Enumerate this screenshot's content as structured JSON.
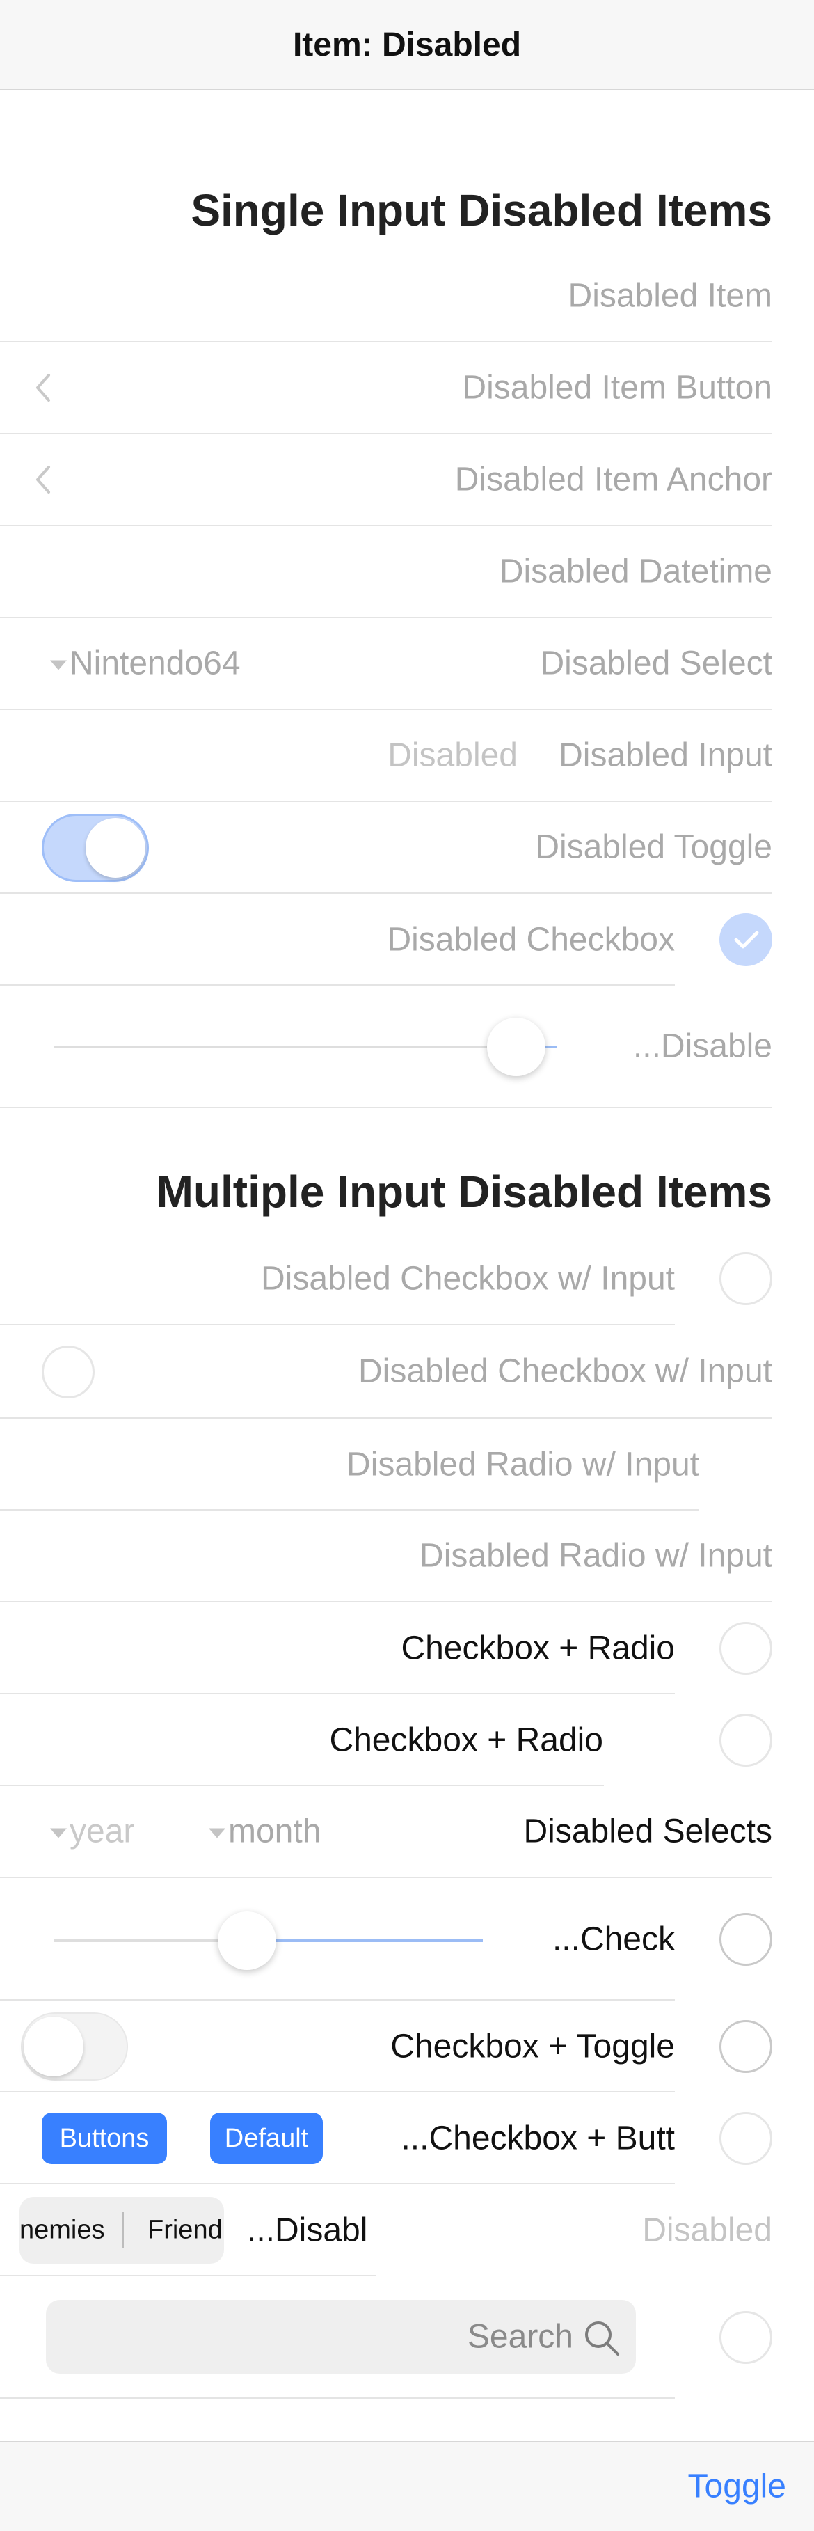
{
  "toolbar": {
    "title": "Item: Disabled"
  },
  "single": {
    "heading": "Single Input Disabled Items",
    "item": "Disabled Item",
    "item_button": "Disabled Item Button",
    "item_anchor": "Disabled Item Anchor",
    "datetime": "Disabled Datetime",
    "select_value": "Nintendo64",
    "select_label": "Disabled Select",
    "input_value": "Disabled",
    "input_label": "Disabled Input",
    "toggle_label": "Disabled Toggle",
    "checkbox_label": "Disabled Checkbox",
    "range_label": "...Disable",
    "range_value": 0.92
  },
  "multiple": {
    "heading": "Multiple Input Disabled Items",
    "checkbox_input_1": "Disabled Checkbox w/ Input",
    "checkbox_input_2": "Disabled Checkbox w/ Input",
    "radio_input_1": "Disabled Radio w/ Input",
    "radio_input_2": "Disabled Radio w/ Input",
    "checkbox_radio_1": "Checkbox + Radio",
    "checkbox_radio_2": "Checkbox + Radio",
    "year_placeholder": "year",
    "month_placeholder": "month",
    "selects_label": "Disabled Selects",
    "range_check_label": "...Check",
    "range_check_value": 0.45,
    "checkbox_toggle": "Checkbox + Toggle",
    "button_1": "Buttons",
    "button_2": "Default",
    "checkbox_button": "...Checkbox + Butt",
    "segment_1": "nemies",
    "segment_2": "Friend",
    "segment_label": "...Disabl",
    "segment_disabled": "Disabled",
    "search_placeholder": "Search"
  },
  "footer": {
    "toggle": "Toggle"
  },
  "colors": {
    "primary": "#3880ff",
    "disabled_primary": "#c5d8fc",
    "disabled_text": "#a9a9a9"
  }
}
